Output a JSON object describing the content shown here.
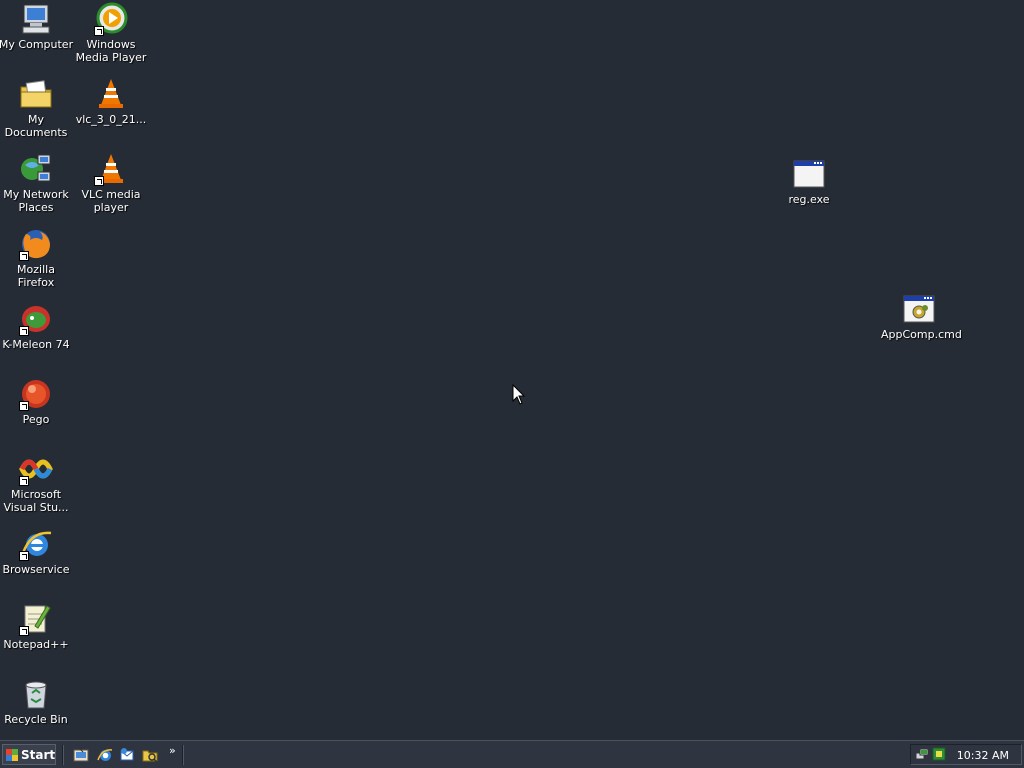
{
  "desktop": {
    "icons": [
      {
        "label": "My Computer",
        "icon": "my-computer-icon"
      },
      {
        "label": "Windows Media Player",
        "icon": "windows-media-player-icon"
      },
      {
        "label": "My Documents",
        "icon": "my-documents-icon"
      },
      {
        "label": "vlc_3_0_21...",
        "icon": "vlc-installer-icon"
      },
      {
        "label": "My Network Places",
        "icon": "my-network-places-icon"
      },
      {
        "label": "VLC media player",
        "icon": "vlc-icon"
      },
      {
        "label": "Mozilla Firefox",
        "icon": "firefox-icon"
      },
      {
        "label": "K-Meleon 74",
        "icon": "k-meleon-icon"
      },
      {
        "label": "Pego",
        "icon": "pego-icon"
      },
      {
        "label": "Microsoft Visual Stu...",
        "icon": "visual-studio-icon"
      },
      {
        "label": "Browservice",
        "icon": "internet-explorer-icon"
      },
      {
        "label": "Notepad++",
        "icon": "notepad-plus-plus-icon"
      },
      {
        "label": "Recycle Bin",
        "icon": "recycle-bin-icon"
      },
      {
        "label": "reg.exe",
        "icon": "executable-icon"
      },
      {
        "label": "AppComp.cmd",
        "icon": "cmd-script-icon"
      }
    ]
  },
  "taskbar": {
    "start_label": "Start",
    "quick_launch": [
      "show-desktop-icon",
      "internet-explorer-icon",
      "outlook-express-icon",
      "windows-explorer-icon"
    ],
    "chevron": "»",
    "tray_icons": [
      "network-tray-icon",
      "security-tray-icon"
    ],
    "clock": "10:32 AM"
  },
  "colors": {
    "desktop_background": "#262c36",
    "taskbar": "#2f3540"
  }
}
